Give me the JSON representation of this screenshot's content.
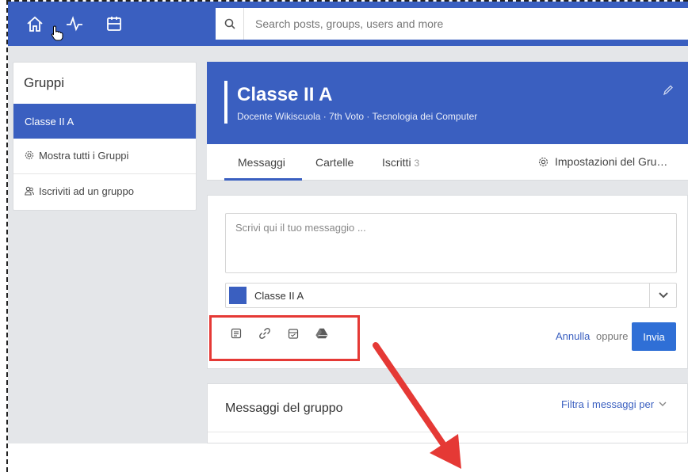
{
  "colors": {
    "brand": "#3a5fc0",
    "annotation": "#e53935",
    "send_button": "#2f6fd6"
  },
  "nav": {
    "icons": [
      "home-icon",
      "activity-icon",
      "calendar-icon"
    ]
  },
  "search": {
    "placeholder": "Search posts, groups, users and more"
  },
  "sidebar": {
    "title": "Gruppi",
    "active_item": "Classe II A",
    "items": [
      {
        "label": "Mostra tutti i Gruppi",
        "icon": "gear-icon"
      },
      {
        "label": "Iscriviti ad un gruppo",
        "icon": "users-icon"
      }
    ]
  },
  "group": {
    "title": "Classe II A",
    "subtitle": "Docente Wikiscuola · 7th Voto · Tecnologia dei Computer"
  },
  "tabs": {
    "messages": "Messaggi",
    "folders": "Cartelle",
    "members": "Iscritti",
    "members_count": "3",
    "settings": "Impostazioni del Gru…"
  },
  "composer": {
    "placeholder": "Scrivi qui il tuo messaggio ...",
    "selected_group": "Classe II A",
    "tools": [
      "note-icon",
      "link-icon",
      "calendar-icon",
      "drive-icon"
    ],
    "cancel": "Annulla",
    "or": "oppure",
    "send": "Invia"
  },
  "messages_panel": {
    "title": "Messaggi del gruppo",
    "filter": "Filtra i messaggi per"
  }
}
